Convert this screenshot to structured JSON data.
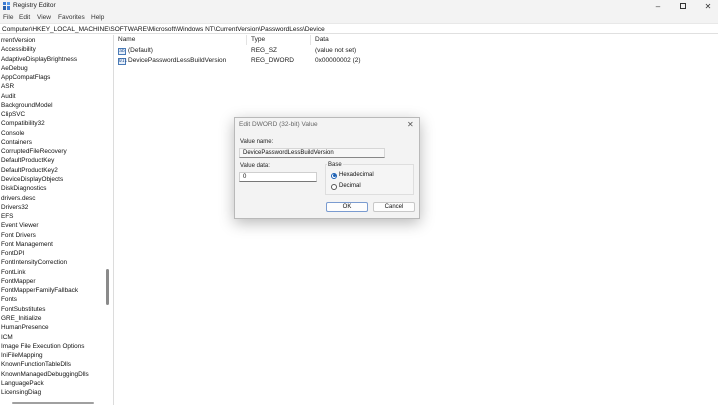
{
  "window": {
    "title": "Registry Editor"
  },
  "menu": [
    "File",
    "Edit",
    "View",
    "Favorites",
    "Help"
  ],
  "address": "Computer\\HKEY_LOCAL_MACHINE\\SOFTWARE\\Microsoft\\Windows NT\\CurrentVersion\\PasswordLess\\Device",
  "tree": [
    "rrentVersion",
    "Accessibility",
    "AdaptiveDisplayBrightness",
    "AeDebug",
    "AppCompatFlags",
    "ASR",
    "Audit",
    "BackgroundModel",
    "ClipSVC",
    "Compatibility32",
    "Console",
    "Containers",
    "CorruptedFileRecovery",
    "DefaultProductKey",
    "DefaultProductKey2",
    "DeviceDisplayObjects",
    "DiskDiagnostics",
    "drivers.desc",
    "Drivers32",
    "EFS",
    "Event Viewer",
    "Font Drivers",
    "Font Management",
    "FontDPI",
    "FontIntensityCorrection",
    "FontLink",
    "FontMapper",
    "FontMapperFamilyFallback",
    "Fonts",
    "FontSubstitutes",
    "GRE_Initialize",
    "HumanPresence",
    "ICM",
    "Image File Execution Options",
    "IniFileMapping",
    "KnownFunctionTableDlls",
    "KnownManagedDebuggingDlls",
    "LanguagePack",
    "LicensingDiag"
  ],
  "columns": {
    "name": "Name",
    "type": "Type",
    "data": "Data"
  },
  "values": [
    {
      "icon": "ab",
      "name": "(Default)",
      "type": "REG_SZ",
      "data": "(value not set)"
    },
    {
      "icon": "011",
      "name": "DevicePasswordLessBuildVersion",
      "type": "REG_DWORD",
      "data": "0x00000002 (2)"
    }
  ],
  "dialog": {
    "title": "Edit DWORD (32-bit) Value",
    "value_name_label": "Value name:",
    "value_name": "DevicePasswordLessBuildVersion",
    "value_data_label": "Value data:",
    "value_data": "0",
    "base_label": "Base",
    "hex_label": "Hexadecimal",
    "dec_label": "Decimal",
    "selected_base": "Hexadecimal",
    "ok_label": "OK",
    "cancel_label": "Cancel"
  }
}
